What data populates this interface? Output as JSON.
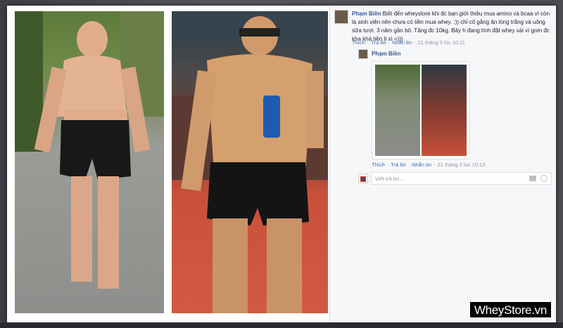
{
  "comments": [
    {
      "author": "Phạm Biền",
      "text": "Biết đến wheystore khi đc bạn giới thiệu mua amino và bcaa vì còn là sinh viên nên chưa có tiền mua whey. :)) chỉ cố gắng ăn lòng trắng và uống sữa tươi. 3 năm gần bô. Tăng đc 10kg. Bây h đang tính đặt whey xài vì gom đc kha khá tiền lì xì =)))",
      "actions": {
        "like": "Thích",
        "reply": "Trả lời",
        "message": "Nhắn tin",
        "time": "21 tháng 2 lúc 10:11"
      }
    },
    {
      "author": "Phạm Biền",
      "actions": {
        "like": "Thích",
        "reply": "Trả lời",
        "message": "Nhắn tin",
        "time": "21 tháng 2 lúc 10:13"
      }
    }
  ],
  "reply_box": {
    "placeholder": "Viết trả lời..."
  },
  "watermark": "WheyStore.vn",
  "icons": [
    "camera-icon",
    "emoji-icon"
  ]
}
